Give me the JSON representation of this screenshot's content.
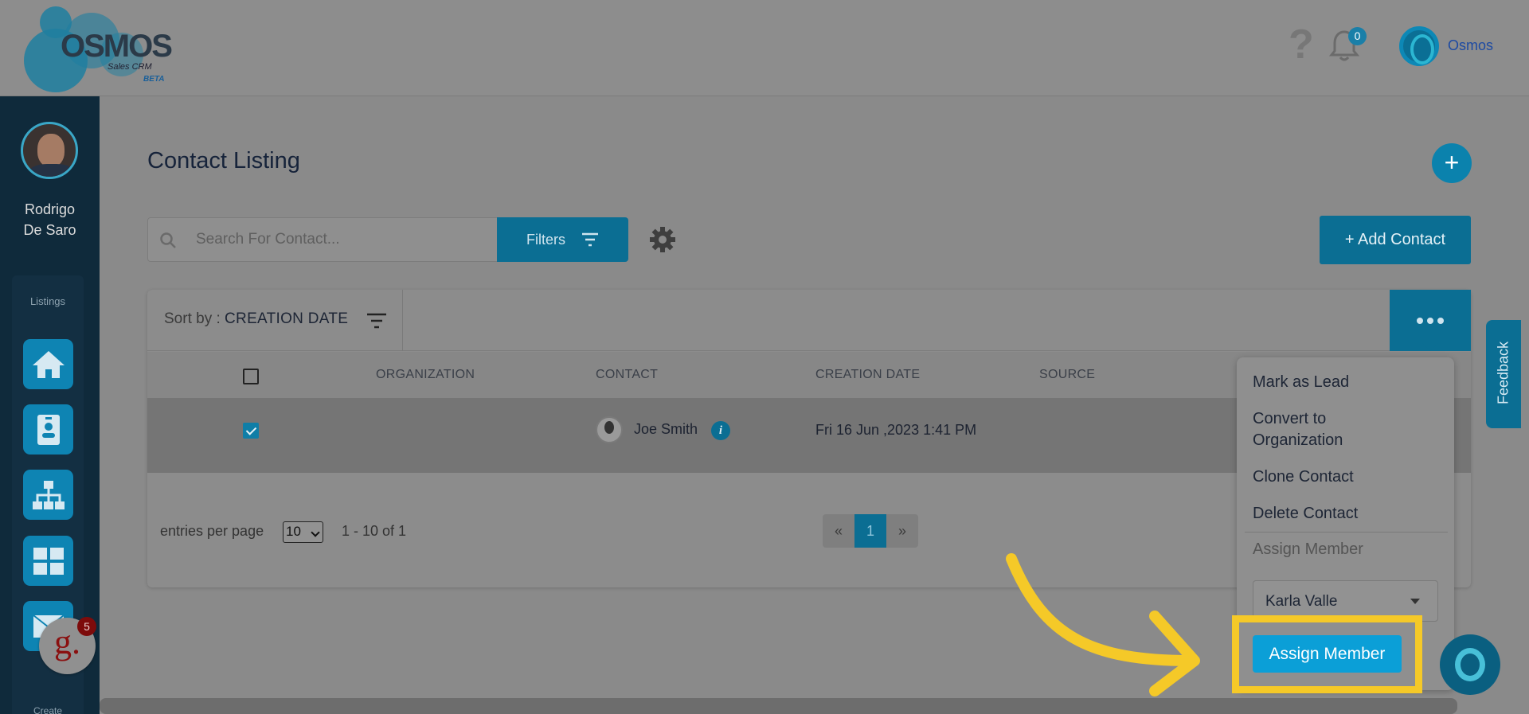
{
  "header": {
    "logo_text": "OSMOS",
    "logo_sub": "Sales CRM",
    "logo_beta": "BETA",
    "help_glyph": "?",
    "notification_count": "0",
    "user_name": "Osmos"
  },
  "sidebar": {
    "profile_first": "Rodrigo",
    "profile_last": "De Saro",
    "section_label": "Listings",
    "create_label": "Create",
    "items": [
      {
        "icon": "home-icon"
      },
      {
        "icon": "contact-card-icon"
      },
      {
        "icon": "org-chart-icon"
      },
      {
        "icon": "grid-icon"
      },
      {
        "icon": "mail-icon"
      }
    ],
    "badge_letter": "g.",
    "badge_count": "5"
  },
  "page": {
    "title": "Contact Listing",
    "add_glyph": "+",
    "search_placeholder": "Search For Contact...",
    "filters_label": "Filters",
    "add_contact_label": "+ Add Contact",
    "sort_prefix": "Sort by : ",
    "sort_value": "CREATION DATE"
  },
  "table": {
    "columns": [
      "ORGANIZATION",
      "CONTACT",
      "CREATION DATE",
      "SOURCE"
    ],
    "rows": [
      {
        "organization": "",
        "contact": "Joe Smith",
        "creation_date": "Fri 16 Jun ,2023 1:41 PM",
        "source": "",
        "checked": true
      }
    ]
  },
  "pagination": {
    "label": "entries per page",
    "per_page": "10",
    "range": "1 - 10 of 1",
    "prev": "«",
    "current": "1",
    "next": "»"
  },
  "menu": {
    "items": [
      "Mark as Lead",
      "Convert to Organization",
      "Clone Contact",
      "Delete Contact"
    ],
    "assign_label": "Assign Member",
    "selected_member": "Karla Valle",
    "assign_button": "Assign Member"
  },
  "feedback_label": "Feedback",
  "colors": {
    "accent": "#0b9fd7",
    "highlight": "#f5c928"
  }
}
